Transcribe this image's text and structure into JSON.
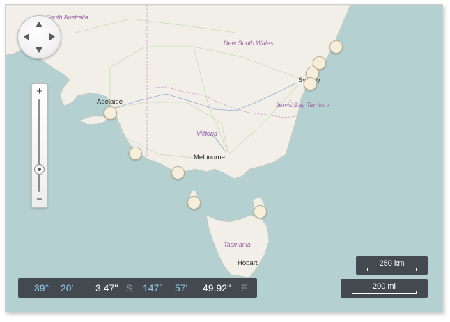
{
  "map": {
    "region_labels": {
      "south_australia": "South Australia",
      "new_south_wales": "New South Wales",
      "jervis_bay": "Jervis Bay Territory",
      "victoria": "Victoria",
      "tasmania": "Tasmania"
    },
    "cities": {
      "adelaide": "Adelaide",
      "melbourne": "Melbourne",
      "sydney": "Sydney",
      "hobart": "Hobart"
    },
    "colors": {
      "water": "#b5d0d0",
      "land": "#f2efe9",
      "border": "#c69ac6",
      "road": "#c8d8b4",
      "marker_fill": "#f7eed9"
    }
  },
  "coordinates": {
    "lat_deg": "39°",
    "lat_min": "20'",
    "lat_sec": "3.47''",
    "lat_dir": "S",
    "lon_deg": "147°",
    "lon_min": "57'",
    "lon_sec": "49.92''",
    "lon_dir": "E"
  },
  "scale": {
    "km_label": "250 km",
    "mi_label": "200 mi"
  },
  "zoom": {
    "in_label": "+",
    "out_label": "−"
  }
}
